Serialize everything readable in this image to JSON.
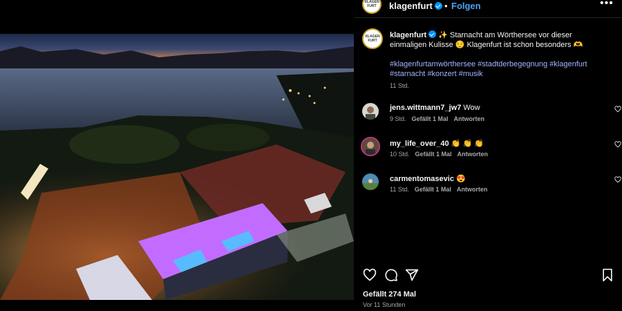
{
  "post": {
    "username": "klagenfurt",
    "follow_label": "Folgen",
    "separator": "•",
    "more_label": "•••",
    "caption_text": "✨ Starnacht am Wörthersee vor dieser einmaligen Kulisse 😌 Klagenfurt ist schon besonders 🫶",
    "hashtags": [
      "#klagenfurtamwörthersee",
      "#stadtderbegegnung",
      "#klagenfurt",
      "#starnacht",
      "#konzert",
      "#musik"
    ],
    "caption_time": "11 Std.",
    "likes": "Gefällt 274 Mal",
    "posted_ago": "Vor 11 Stunden"
  },
  "comments": [
    {
      "user": "jens.wittmann7_jw7",
      "text": "Wow",
      "time": "9 Std.",
      "likes": "Gefällt 1 Mal",
      "reply": "Antworten"
    },
    {
      "user": "my_life_over_40",
      "text": "👏 👏 👏",
      "time": "10 Std.",
      "likes": "Gefällt 1 Mal",
      "reply": "Antworten"
    },
    {
      "user": "carmentomasevic",
      "text": "😍",
      "time": "11 Std.",
      "likes": "Gefällt 1 Mal",
      "reply": "Antworten"
    }
  ],
  "colors": {
    "accent_link": "#4aa3f0",
    "hashtag": "#a5b4ff",
    "verified": "#0095f6",
    "muted": "#a8a8a8"
  },
  "icons": [
    "verified-badge-icon",
    "more-options-icon",
    "heart-icon",
    "comment-icon",
    "share-icon",
    "bookmark-icon"
  ]
}
